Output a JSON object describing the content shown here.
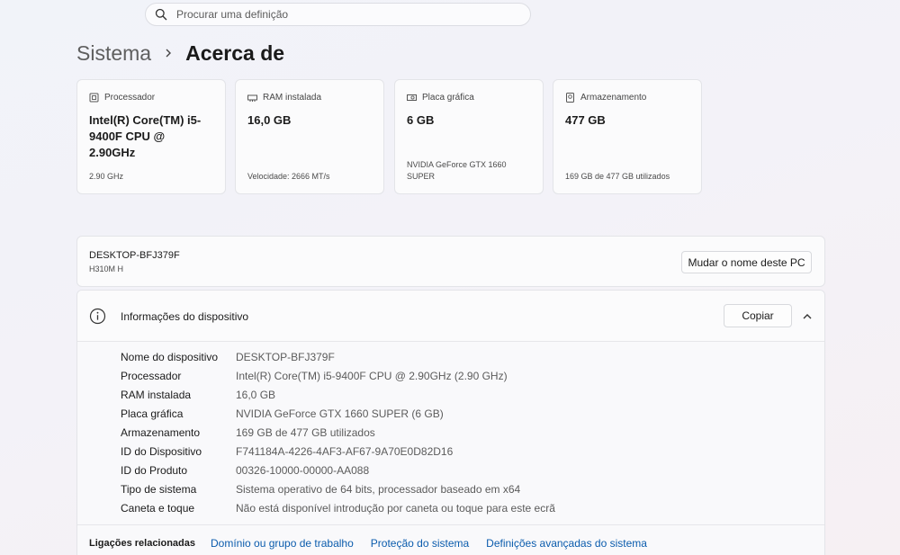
{
  "search": {
    "placeholder": "Procurar uma definição",
    "icon": "search-icon"
  },
  "breadcrumb": {
    "parent": "Sistema",
    "current": "Acerca de"
  },
  "cards": [
    {
      "icon": "processor-icon",
      "title": "Processador",
      "value": "Intel(R) Core(TM) i5-9400F CPU @ 2.90GHz",
      "sub": "2.90 GHz"
    },
    {
      "icon": "ram-icon",
      "title": "RAM instalada",
      "value": "16,0 GB",
      "sub": "Velocidade: 2666 MT/s"
    },
    {
      "icon": "graphics-card-icon",
      "title": "Placa gráfica",
      "value": "6 GB",
      "sub": "NVIDIA GeForce GTX 1660 SUPER"
    },
    {
      "icon": "storage-icon",
      "title": "Armazenamento",
      "value": "477 GB",
      "sub": "169 GB de 477 GB utilizados"
    }
  ],
  "device": {
    "name": "DESKTOP-BFJ379F",
    "model": "H310M H",
    "rename_label": "Mudar o nome deste PC"
  },
  "info": {
    "title": "Informações do dispositivo",
    "copy_label": "Copiar",
    "rows": [
      {
        "key": "Nome do dispositivo",
        "value": "DESKTOP-BFJ379F"
      },
      {
        "key": "Processador",
        "value": "Intel(R) Core(TM) i5-9400F CPU @ 2.90GHz (2.90 GHz)"
      },
      {
        "key": "RAM instalada",
        "value": "16,0 GB"
      },
      {
        "key": "Placa gráfica",
        "value": "NVIDIA GeForce GTX 1660 SUPER (6 GB)"
      },
      {
        "key": "Armazenamento",
        "value": "169 GB de 477 GB utilizados"
      },
      {
        "key": "ID do Dispositivo",
        "value": "F741184A-4226-4AF3-AF67-9A70E0D82D16"
      },
      {
        "key": "ID do Produto",
        "value": "00326-10000-00000-AA088"
      },
      {
        "key": "Tipo de sistema",
        "value": "Sistema operativo de 64 bits, processador baseado em x64"
      },
      {
        "key": "Caneta e toque",
        "value": "Não está disponível introdução por caneta ou toque para este ecrã"
      }
    ]
  },
  "related": {
    "title": "Ligações relacionadas",
    "links": [
      "Domínio ou grupo de trabalho",
      "Proteção do sistema",
      "Definições avançadas do sistema"
    ]
  },
  "colors": {
    "link": "#0b5cad",
    "background": "#f2f2f8"
  }
}
